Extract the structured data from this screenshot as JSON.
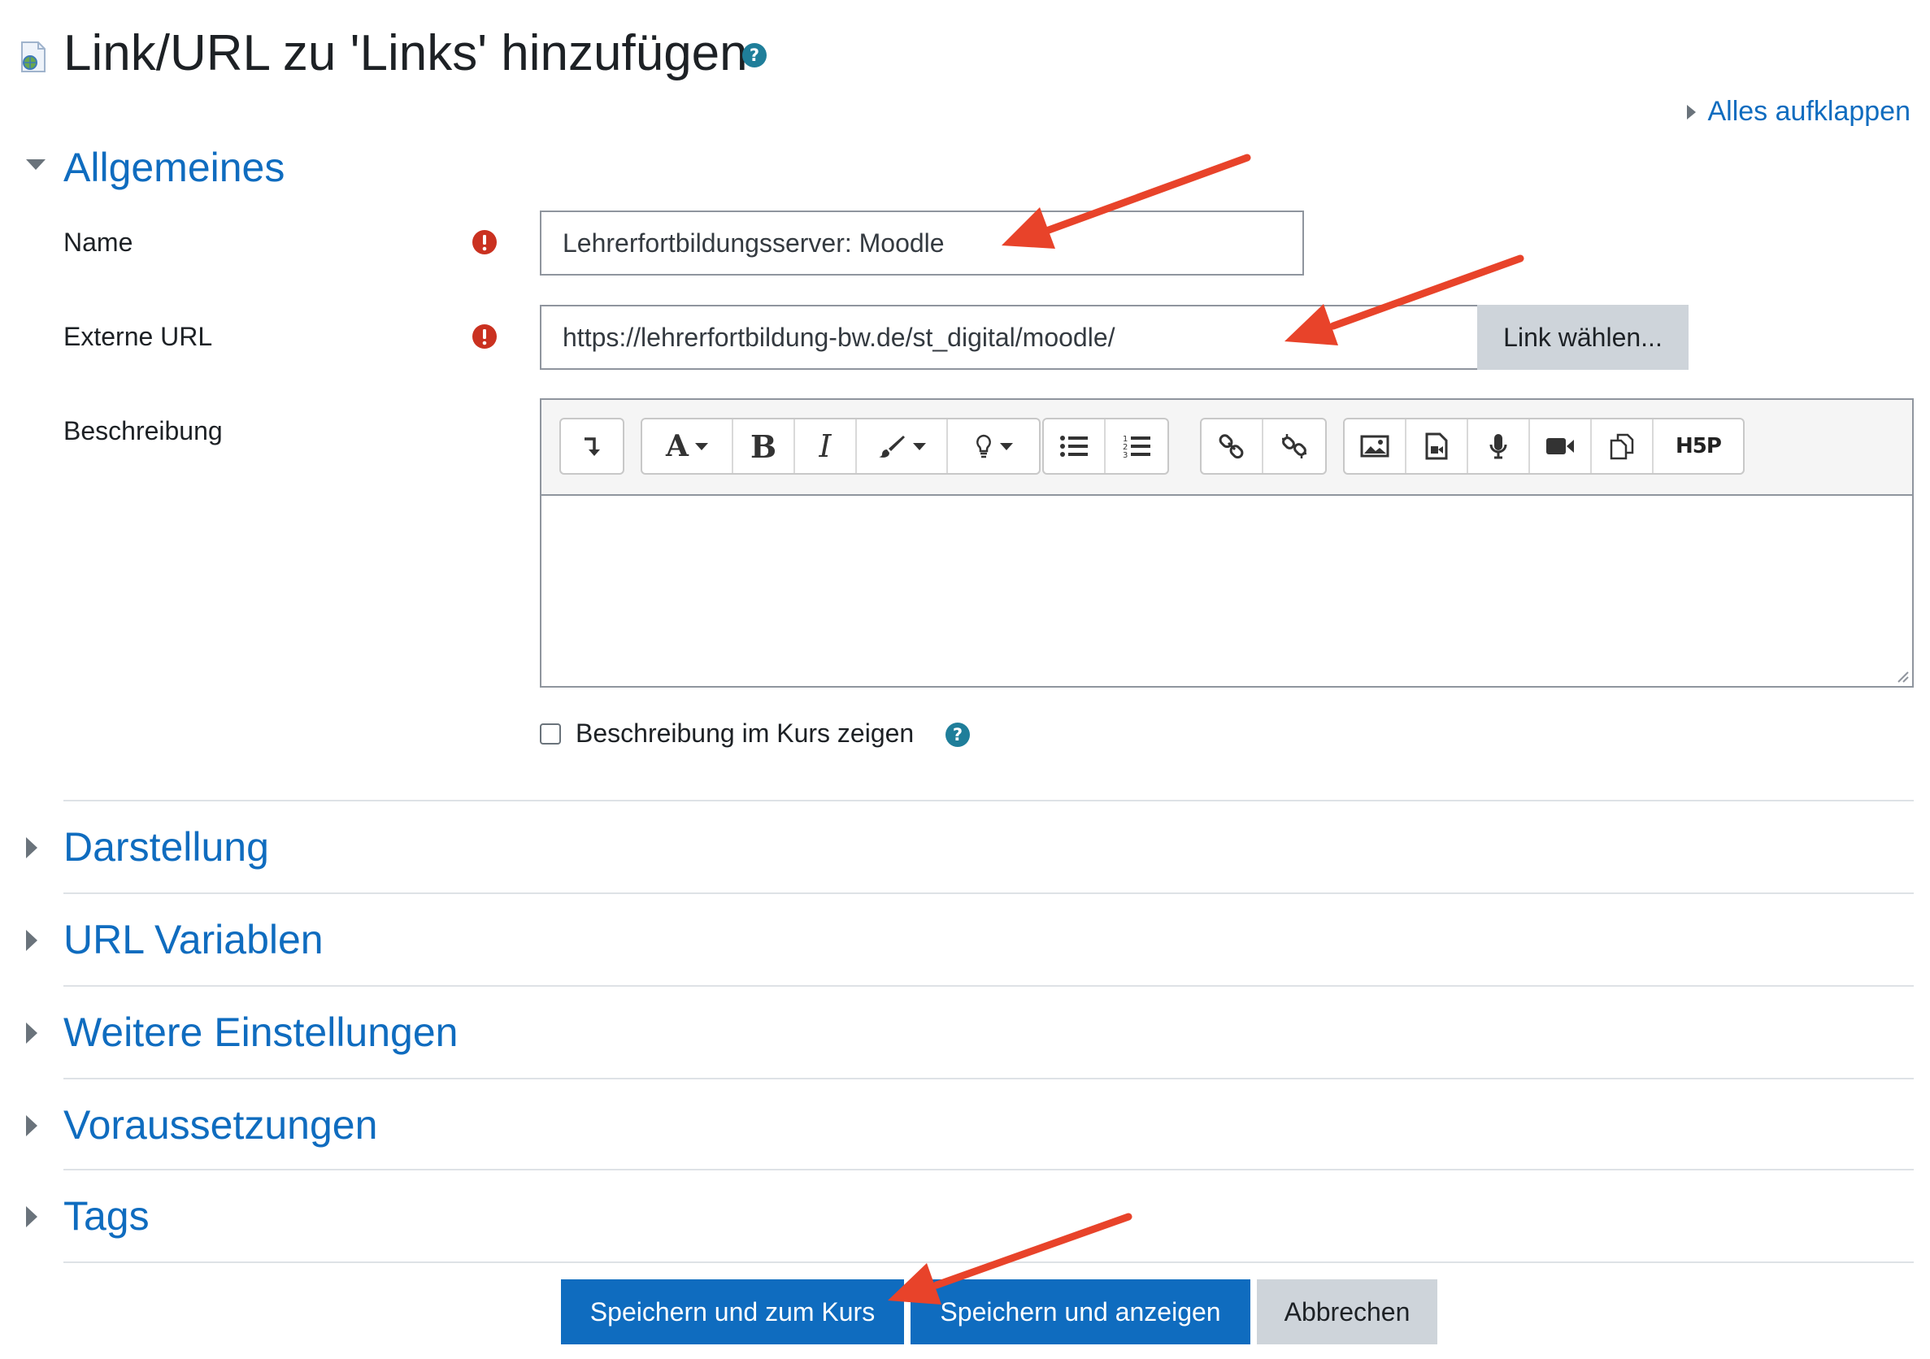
{
  "page": {
    "title": "Link/URL zu 'Links' hinzufügen",
    "expand_all": "Alles aufklappen"
  },
  "sections": {
    "general": "Allgemeines",
    "collapsed": [
      "Darstellung",
      "URL Variablen",
      "Weitere Einstellungen",
      "Voraussetzungen",
      "Tags"
    ]
  },
  "form": {
    "name_label": "Name",
    "name_value": "Lehrerfortbildungsserver: Moodle",
    "url_label": "Externe URL",
    "url_value": "https://lehrerfortbildung-bw.de/st_digital/moodle/",
    "choose_link_button": "Link wählen...",
    "description_label": "Beschreibung",
    "show_description_label": "Beschreibung im Kurs zeigen",
    "show_description_checked": false
  },
  "editor": {
    "toolbar_groups": [
      [
        "collapse-icon"
      ],
      [
        "font-style-icon",
        "bold-icon",
        "italic-icon",
        "paintbrush-icon",
        "lightbulb-icon"
      ],
      [
        "unordered-list-icon",
        "ordered-list-icon"
      ],
      [
        "link-icon",
        "unlink-icon"
      ],
      [
        "image-icon",
        "media-icon",
        "microphone-icon",
        "video-icon",
        "manage-files-icon",
        "h5p-icon"
      ]
    ],
    "h5p_text": "H5P",
    "content": ""
  },
  "buttons": {
    "save_return": "Speichern und zum Kurs",
    "save_display": "Speichern und anzeigen",
    "cancel": "Abbrechen"
  },
  "colors": {
    "primary": "#0f6cbf",
    "secondary": "#ced4da",
    "required": "#ca3120",
    "help": "#1f7e9a",
    "annotation_arrow": "#e8432a"
  }
}
